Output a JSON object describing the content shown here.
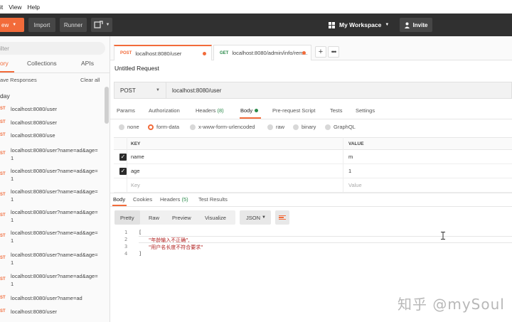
{
  "menu": [
    "it",
    "View",
    "Help"
  ],
  "header": {
    "new_label": "ew",
    "import_label": "Import",
    "runner_label": "Runner",
    "workspace_label": "My Workspace",
    "invite_label": "Invite"
  },
  "sidebar": {
    "filter_placeholder": "ilter",
    "tabs": [
      "ory",
      "Collections",
      "APIs"
    ],
    "save_responses": "ave Responses",
    "clear_all": "Clear all",
    "group_label": "day",
    "items": [
      {
        "method": "ST",
        "url": "localhost:8080/user"
      },
      {
        "method": "ST",
        "url": "localhost:8080/user"
      },
      {
        "method": "ST",
        "url": "localhost:8080/use"
      },
      {
        "method": "ST",
        "url": "localhost:8080/user?name=ad&age=1"
      },
      {
        "method": "ST",
        "url": "localhost:8080/user?name=ad&age=1"
      },
      {
        "method": "ST",
        "url": "localhost:8080/user?name=ad&age=1"
      },
      {
        "method": "ST",
        "url": "localhost:8080/user?name=ad&age=1"
      },
      {
        "method": "ST",
        "url": "localhost:8080/user?name=ad&age=1"
      },
      {
        "method": "ST",
        "url": "localhost:8080/user?name=ad&age=1"
      },
      {
        "method": "ST",
        "url": "localhost:8080/user?name=ad&age=1"
      },
      {
        "method": "ST",
        "url": "localhost:8080/user?name=ad"
      },
      {
        "method": "ST",
        "url": "localhost:8080/user"
      }
    ]
  },
  "tabs": [
    {
      "method": "POST",
      "label": "localhost:8080/user"
    },
    {
      "method": "GET",
      "label": "localhost:8080/admin/info/rem..."
    }
  ],
  "request": {
    "title": "Untitled Request",
    "method": "POST",
    "url": "localhost:8080/user"
  },
  "req_tabs": {
    "params": "Params",
    "authorization": "Authorization",
    "headers": "Headers",
    "headers_count": "(8)",
    "body": "Body",
    "prerequest": "Pre-request Script",
    "tests": "Tests",
    "settings": "Settings"
  },
  "body_options": [
    "none",
    "form-data",
    "x-www-form-urlencoded",
    "raw",
    "binary",
    "GraphQL"
  ],
  "kv": {
    "key_header": "KEY",
    "value_header": "VALUE",
    "rows": [
      {
        "key": "name",
        "value": "m"
      },
      {
        "key": "age",
        "value": "1"
      }
    ],
    "key_placeholder": "Key",
    "value_placeholder": "Value"
  },
  "response_tabs": {
    "body": "Body",
    "cookies": "Cookies",
    "headers": "Headers",
    "headers_count": "(5)",
    "test_results": "Test Results"
  },
  "format": {
    "pretty": "Pretty",
    "raw": "Raw",
    "preview": "Preview",
    "visualize": "Visualize",
    "json": "JSON"
  },
  "code_lines": [
    {
      "num": "1",
      "text": "["
    },
    {
      "num": "2",
      "text": "\"年龄输入不正确\","
    },
    {
      "num": "3",
      "text": "\"用户名长度不符合要求\""
    },
    {
      "num": "4",
      "text": "]"
    }
  ],
  "watermark": "知乎 @mySoul"
}
